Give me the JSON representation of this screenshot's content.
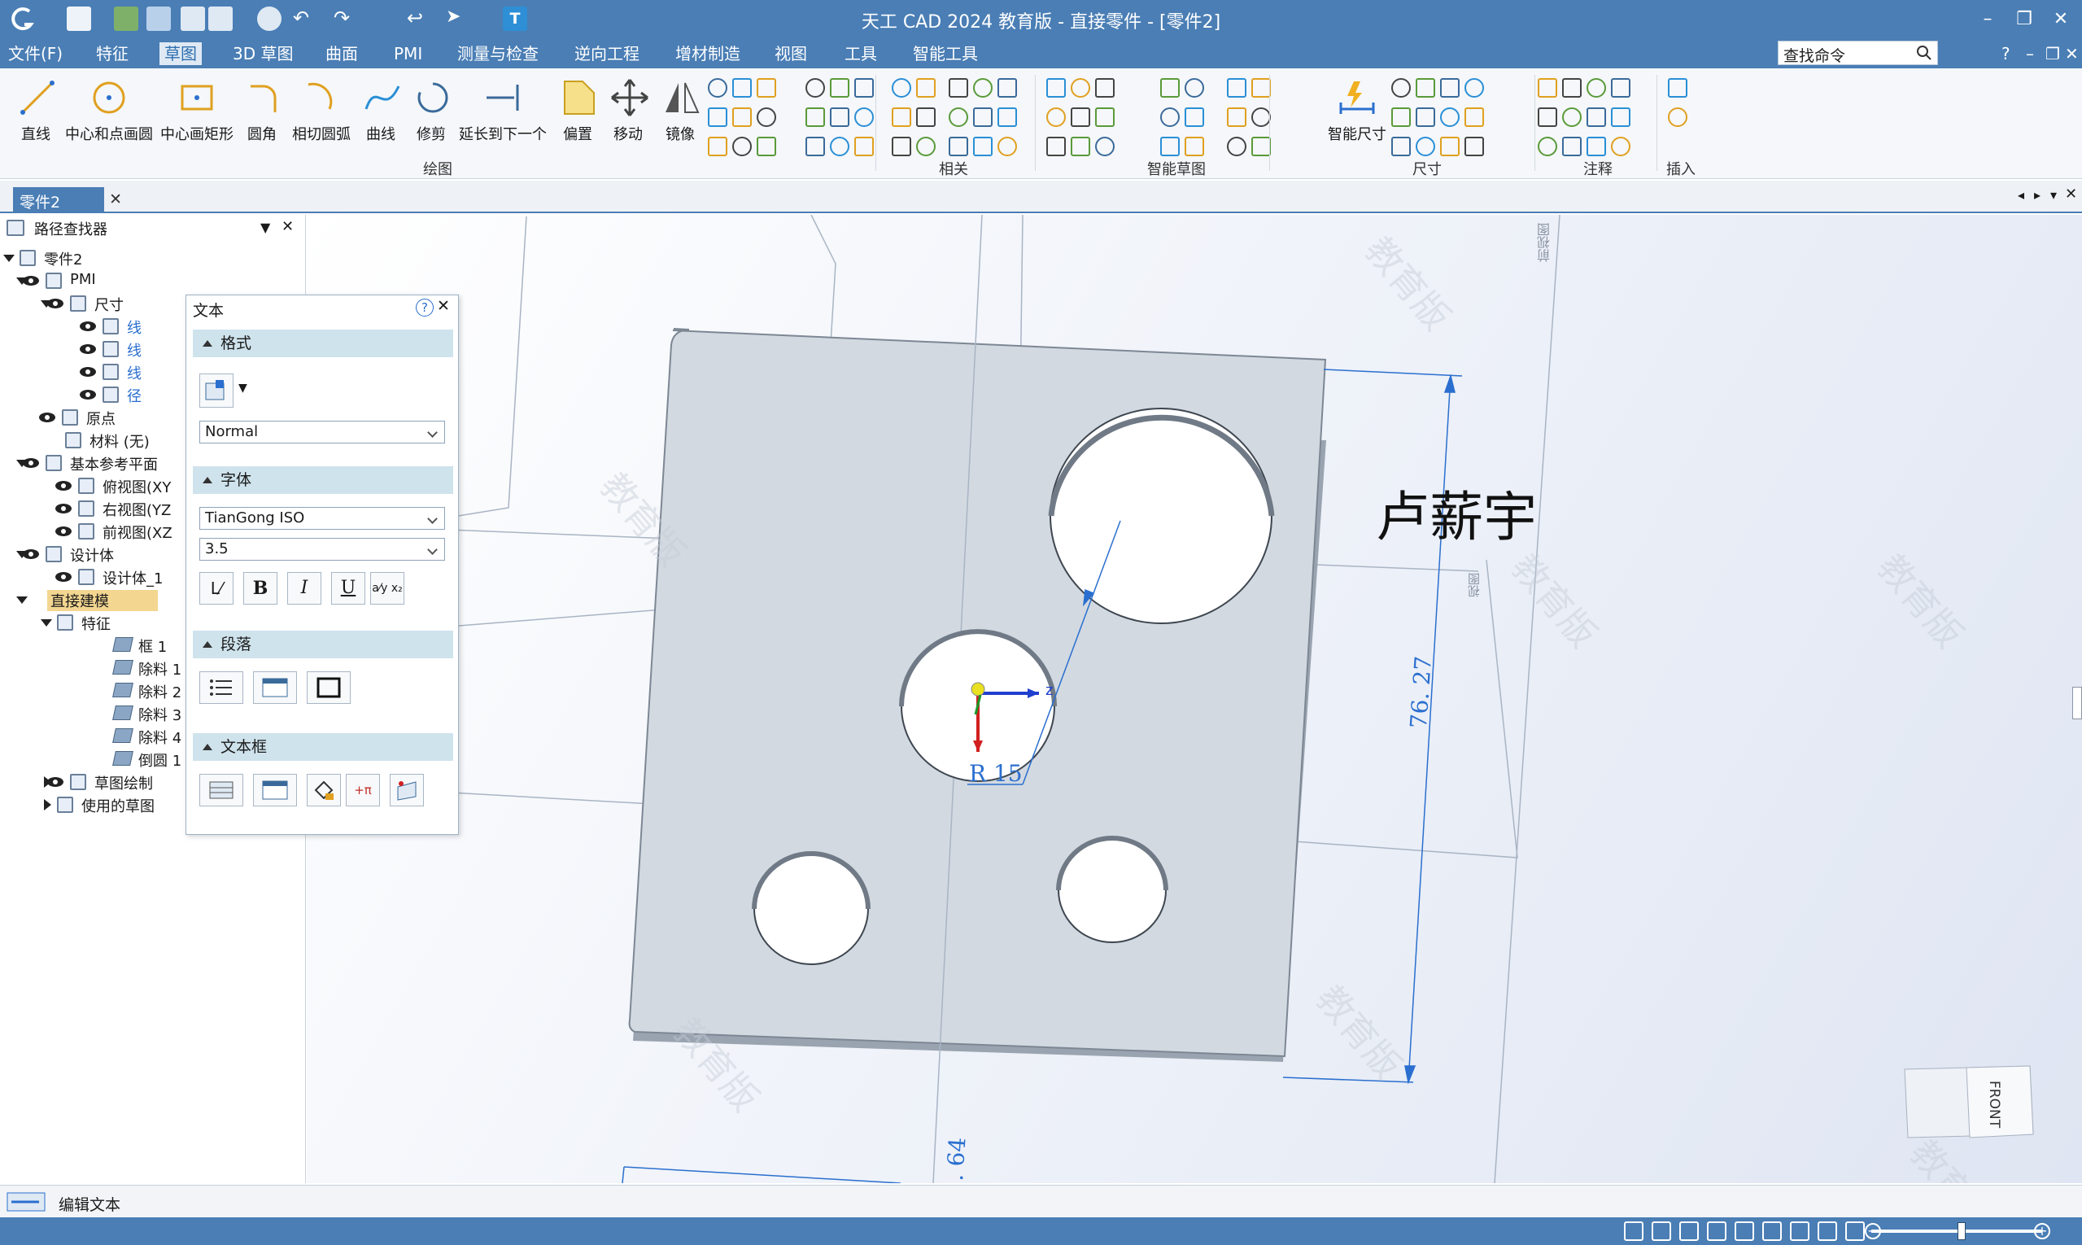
{
  "titlebar": {
    "title": "天工 CAD 2024 教育版 - 直接零件 - [零件2]",
    "minimize": "–",
    "restore": "❐",
    "close": "✕"
  },
  "menu": {
    "items": [
      "文件(F)",
      "特征",
      "草图",
      "3D 草图",
      "曲面",
      "PMI",
      "测量与检查",
      "逆向工程",
      "增材制造",
      "视图",
      "工具",
      "智能工具"
    ],
    "active_index": 2,
    "search_placeholder": "查找命令",
    "help": "?",
    "min": "–",
    "restore": "❐",
    "close": "✕"
  },
  "ribbon": {
    "buttons": [
      {
        "label": "直线",
        "icon": "line-icon"
      },
      {
        "label": "中心和点画圆",
        "icon": "circle-icon"
      },
      {
        "label": "中心画矩形",
        "icon": "rectangle-icon"
      },
      {
        "label": "圆角",
        "icon": "fillet-icon"
      },
      {
        "label": "相切圆弧",
        "icon": "tangent-arc-icon"
      },
      {
        "label": "曲线",
        "icon": "curve-icon"
      },
      {
        "label": "修剪",
        "icon": "trim-icon"
      },
      {
        "label": "延长到下一个",
        "icon": "extend-icon"
      },
      {
        "label": "偏置",
        "icon": "offset-icon"
      },
      {
        "label": "移动",
        "icon": "move-icon"
      },
      {
        "label": "镜像",
        "icon": "mirror-icon"
      },
      {
        "label": "智能尺寸",
        "icon": "smart-dimension-icon"
      }
    ],
    "groups": [
      "绘图",
      "相关",
      "智能草图",
      "尺寸",
      "注释",
      "插入"
    ]
  },
  "doc_tab": {
    "label": "零件2",
    "close": "✕"
  },
  "pathfinder": {
    "title": "路径查找器",
    "items": [
      {
        "label": "零件2"
      },
      {
        "label": "PMI"
      },
      {
        "label": "尺寸"
      },
      {
        "label": "线"
      },
      {
        "label": "线"
      },
      {
        "label": "线"
      },
      {
        "label": "径"
      },
      {
        "label": "原点"
      },
      {
        "label": "材料 (无)"
      },
      {
        "label": "基本参考平面"
      },
      {
        "label": "俯视图(XY"
      },
      {
        "label": "右视图(YZ"
      },
      {
        "label": "前视图(XZ"
      },
      {
        "label": "设计体"
      },
      {
        "label": "设计体_1"
      },
      {
        "label": "直接建模"
      },
      {
        "label": "特征"
      },
      {
        "label": "框 1"
      },
      {
        "label": "除料 1"
      },
      {
        "label": "除料 2"
      },
      {
        "label": "除料 3"
      },
      {
        "label": "除料 4"
      },
      {
        "label": "倒圆 1"
      },
      {
        "label": "草图绘制"
      },
      {
        "label": "使用的草图"
      }
    ]
  },
  "text_dialog": {
    "title": "文本",
    "help": "?",
    "close": "✕",
    "sections": {
      "format": "格式",
      "font": "字体",
      "paragraph": "段落",
      "textbox": "文本框"
    },
    "style_value": "Normal",
    "font_value": "TianGong ISO",
    "size_value": "3.5",
    "bold": "B",
    "italic": "I",
    "underline": "U"
  },
  "viewport": {
    "annotation_text": "卢薪宇",
    "dim_vertical": "76. 27",
    "dim_radius": "R 15",
    "dim_bottom": ". 64",
    "axis_z": "z",
    "watermark": "教育版",
    "view_label_top": "前视图",
    "view_label_side": "视图",
    "viewcube_label": "FRONT"
  },
  "status": {
    "text": "编辑文本"
  },
  "colors": {
    "titlebar": "#4a7eb5",
    "plate": "#d2d9e1",
    "dimension": "#2a6fcf",
    "section_header": "#cfe3ec"
  }
}
